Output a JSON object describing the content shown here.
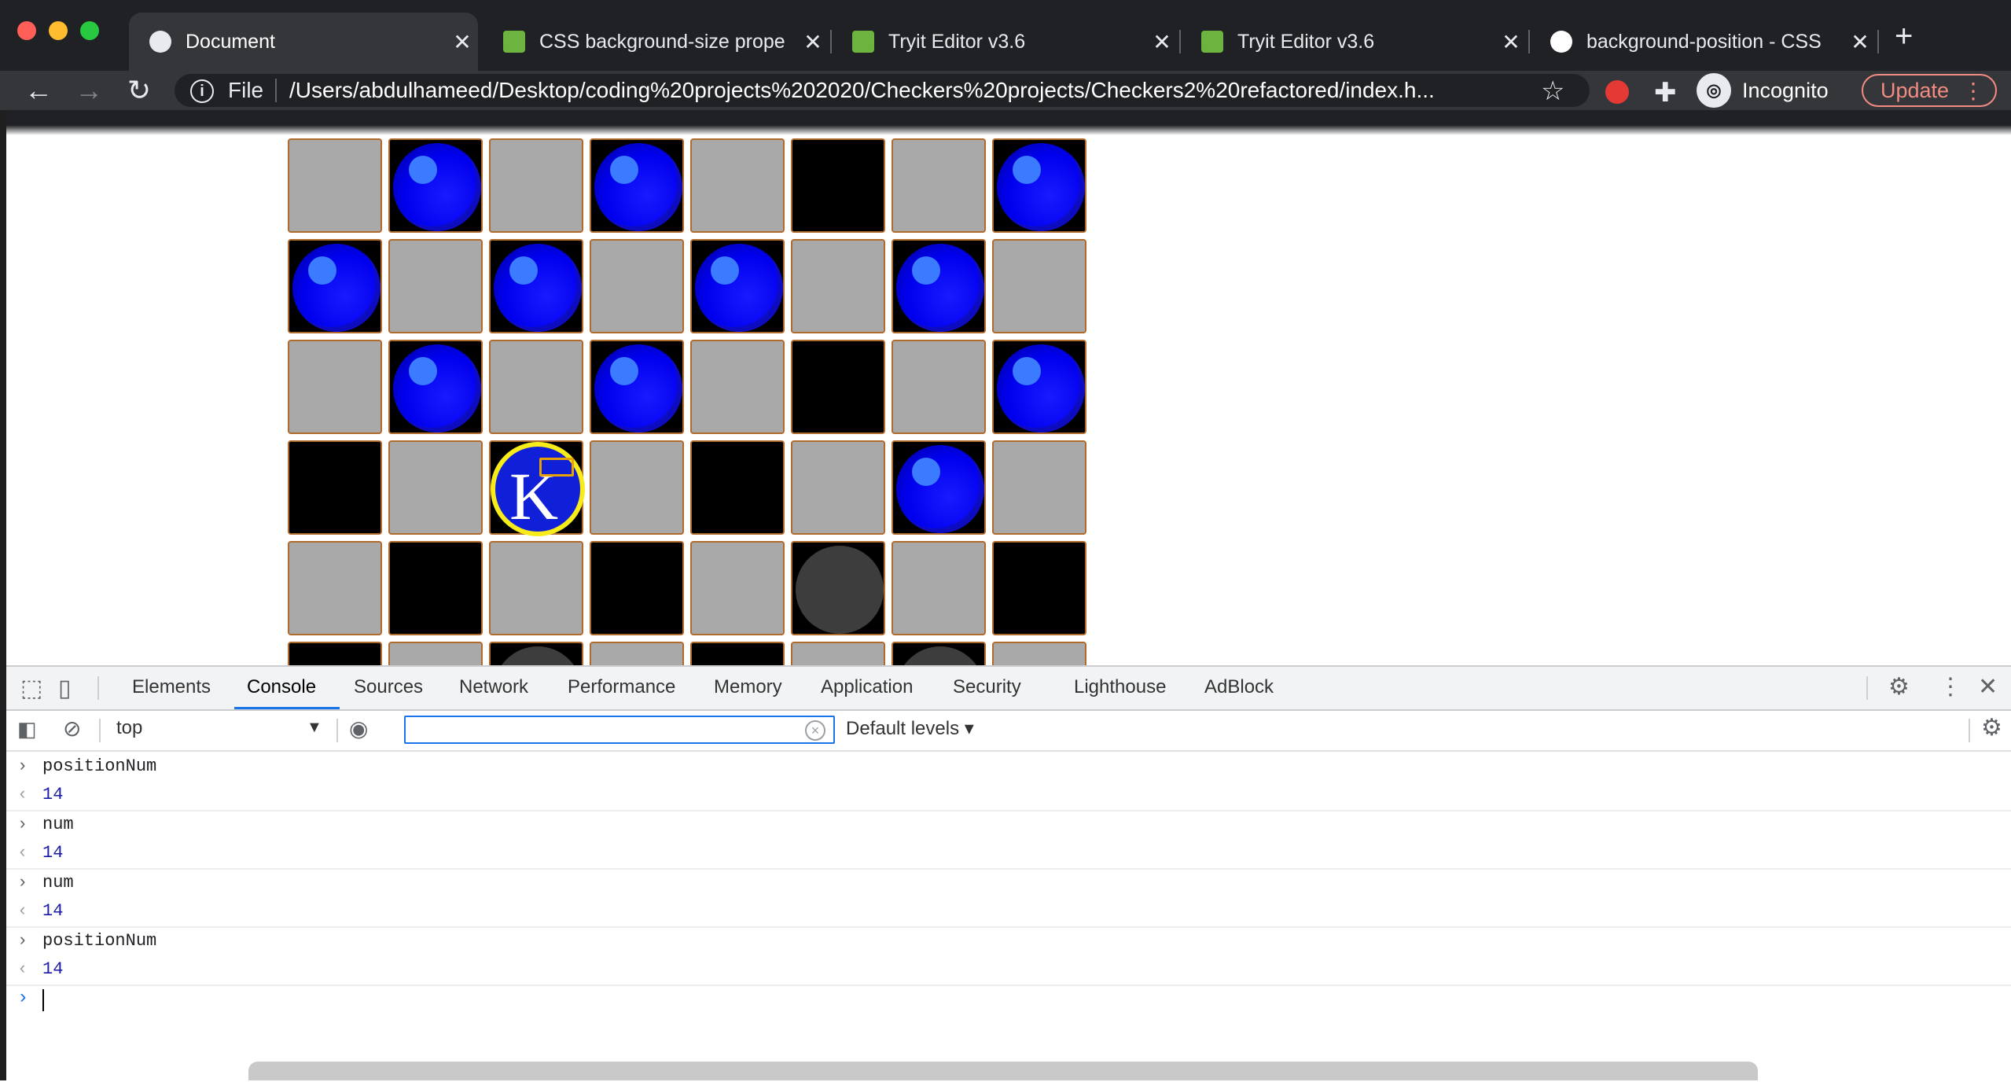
{
  "window": {
    "tabs": [
      {
        "title": "Document",
        "active": true
      },
      {
        "title": "CSS background-size prope",
        "active": false
      },
      {
        "title": "Tryit Editor v3.6",
        "active": false
      },
      {
        "title": "Tryit Editor v3.6",
        "active": false
      },
      {
        "title": "background-position - CSS",
        "active": false
      }
    ]
  },
  "toolbar": {
    "file_label": "File",
    "url": "/Users/abdulhameed/Desktop/coding%20projects%202020/Checkers%20projects/Checkers2%20refactored/index.h...",
    "profile_label": "Incognito",
    "update_label": "Update"
  },
  "board": {
    "columns": 8,
    "visible_rows": 6,
    "rows": [
      [
        "L",
        "B",
        "L",
        "B",
        "L",
        "D",
        "L",
        "B"
      ],
      [
        "B",
        "L",
        "B",
        "L",
        "B",
        "L",
        "B",
        "L"
      ],
      [
        "L",
        "B",
        "L",
        "B",
        "L",
        "D",
        "L",
        "B"
      ],
      [
        "D",
        "L",
        "K",
        "L",
        "D",
        "L",
        "B",
        "L"
      ],
      [
        "L",
        "D",
        "L",
        "D",
        "L",
        "G",
        "L",
        "D"
      ],
      [
        "D",
        "L",
        "G",
        "L",
        "D",
        "L",
        "G",
        "L"
      ]
    ],
    "king_letter": "K",
    "colors": {
      "light": "#a9a9a9",
      "dark": "#000000",
      "piece": "#0000ee",
      "king_ring": "#f7ec1a",
      "border": "#b06a2c"
    }
  },
  "devtools": {
    "tabs": [
      "Elements",
      "Console",
      "Sources",
      "Network",
      "Performance",
      "Memory",
      "Application",
      "Security",
      "Lighthouse",
      "AdBlock"
    ],
    "active_tab": "Console",
    "context": "top",
    "filter_placeholder": "",
    "levels_label": "Default levels",
    "console": [
      {
        "input": "positionNum",
        "output": "14"
      },
      {
        "input": "num",
        "output": "14"
      },
      {
        "input": "num",
        "output": "14"
      },
      {
        "input": "positionNum",
        "output": "14"
      }
    ]
  }
}
